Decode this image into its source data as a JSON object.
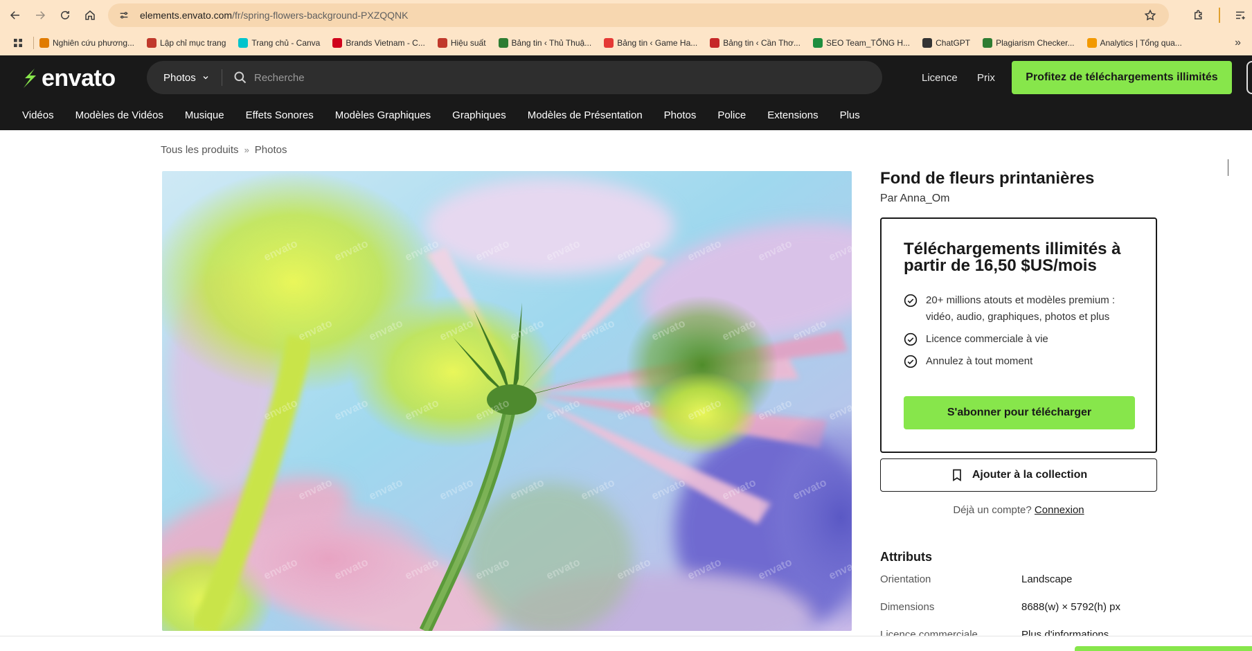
{
  "browser": {
    "url_domain": "elements.envato.com",
    "url_path": "/fr/spring-flowers-background-PXZQQNK",
    "bookmarks": [
      {
        "label": "Nghiên cứu phương...",
        "icon": "123-icon",
        "color": "#e07b00"
      },
      {
        "label": "Lập chỉ mục trang",
        "icon": "rank-icon",
        "color": "#c0392b"
      },
      {
        "label": "Trang chủ - Canva",
        "icon": "canva-icon",
        "color": "#00c4cc"
      },
      {
        "label": "Brands Vietnam - C...",
        "icon": "star-icon",
        "color": "#d0021b"
      },
      {
        "label": "Hiệu suất",
        "icon": "rank-icon",
        "color": "#c0392b"
      },
      {
        "label": "Bảng tin ‹ Thủ Thuậ...",
        "icon": "leaf-icon",
        "color": "#2e7d32"
      },
      {
        "label": "Bảng tin ‹ Game Ha...",
        "icon": "circle-icon",
        "color": "#e53935"
      },
      {
        "label": "Bảng tin ‹ Cần Thơ...",
        "icon": "wave-icon",
        "color": "#c62828"
      },
      {
        "label": "SEO Team_TỔNG H...",
        "icon": "sheet-icon",
        "color": "#1e8e3e"
      },
      {
        "label": "ChatGPT",
        "icon": "openai-icon",
        "color": "#333333"
      },
      {
        "label": "Plagiarism Checker...",
        "icon": "pr-icon",
        "color": "#2e7d32"
      },
      {
        "label": "Analytics | Tổng qua...",
        "icon": "analytics-icon",
        "color": "#f29900"
      }
    ]
  },
  "header": {
    "logo_text": "envato",
    "search_category": "Photos",
    "search_placeholder": "Recherche",
    "link_license": "Licence",
    "link_pricing": "Prix",
    "cta": "Profitez de téléchargements illimités"
  },
  "categories": [
    "Vidéos",
    "Modèles de Vidéos",
    "Musique",
    "Effets Sonores",
    "Modèles Graphiques",
    "Graphiques",
    "Modèles de Présentation",
    "Photos",
    "Police",
    "Extensions",
    "Plus"
  ],
  "breadcrumb": {
    "root": "Tous les produits",
    "sep": "»",
    "current": "Photos"
  },
  "product": {
    "title": "Fond de fleurs printanières",
    "author_prefix": "Par",
    "author": "Anna_Om",
    "watermark": "envato"
  },
  "offer": {
    "title": "Téléchargements illimités à partir de 16,50 $US/mois",
    "features": [
      "20+ millions atouts et modèles premium : vidéo, audio, graphiques, photos et plus",
      "Licence commerciale à vie",
      "Annulez à tout moment"
    ],
    "subscribe": "S'abonner pour télécharger",
    "add_collection": "Ajouter à la collection",
    "account_q": "Déjà un compte?",
    "login": "Connexion"
  },
  "attributes": {
    "heading": "Attributs",
    "rows": [
      {
        "key": "Orientation",
        "value": "Landscape"
      },
      {
        "key": "Dimensions",
        "value": "8688(w) × 5792(h) px"
      },
      {
        "key": "Licence commerciale",
        "value": "Plus d'informations"
      }
    ]
  },
  "colors": {
    "accent": "#87e64b",
    "header_bg": "#191919",
    "browser_bg": "#fde5c8"
  }
}
